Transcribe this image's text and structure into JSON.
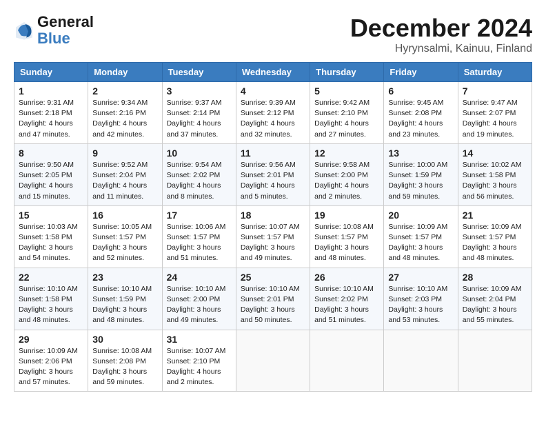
{
  "header": {
    "logo_general": "General",
    "logo_blue": "Blue",
    "month_title": "December 2024",
    "subtitle": "Hyrynsalmi, Kainuu, Finland"
  },
  "weekdays": [
    "Sunday",
    "Monday",
    "Tuesday",
    "Wednesday",
    "Thursday",
    "Friday",
    "Saturday"
  ],
  "weeks": [
    [
      {
        "day": "1",
        "info": "Sunrise: 9:31 AM\nSunset: 2:18 PM\nDaylight: 4 hours\nand 47 minutes."
      },
      {
        "day": "2",
        "info": "Sunrise: 9:34 AM\nSunset: 2:16 PM\nDaylight: 4 hours\nand 42 minutes."
      },
      {
        "day": "3",
        "info": "Sunrise: 9:37 AM\nSunset: 2:14 PM\nDaylight: 4 hours\nand 37 minutes."
      },
      {
        "day": "4",
        "info": "Sunrise: 9:39 AM\nSunset: 2:12 PM\nDaylight: 4 hours\nand 32 minutes."
      },
      {
        "day": "5",
        "info": "Sunrise: 9:42 AM\nSunset: 2:10 PM\nDaylight: 4 hours\nand 27 minutes."
      },
      {
        "day": "6",
        "info": "Sunrise: 9:45 AM\nSunset: 2:08 PM\nDaylight: 4 hours\nand 23 minutes."
      },
      {
        "day": "7",
        "info": "Sunrise: 9:47 AM\nSunset: 2:07 PM\nDaylight: 4 hours\nand 19 minutes."
      }
    ],
    [
      {
        "day": "8",
        "info": "Sunrise: 9:50 AM\nSunset: 2:05 PM\nDaylight: 4 hours\nand 15 minutes."
      },
      {
        "day": "9",
        "info": "Sunrise: 9:52 AM\nSunset: 2:04 PM\nDaylight: 4 hours\nand 11 minutes."
      },
      {
        "day": "10",
        "info": "Sunrise: 9:54 AM\nSunset: 2:02 PM\nDaylight: 4 hours\nand 8 minutes."
      },
      {
        "day": "11",
        "info": "Sunrise: 9:56 AM\nSunset: 2:01 PM\nDaylight: 4 hours\nand 5 minutes."
      },
      {
        "day": "12",
        "info": "Sunrise: 9:58 AM\nSunset: 2:00 PM\nDaylight: 4 hours\nand 2 minutes."
      },
      {
        "day": "13",
        "info": "Sunrise: 10:00 AM\nSunset: 1:59 PM\nDaylight: 3 hours\nand 59 minutes."
      },
      {
        "day": "14",
        "info": "Sunrise: 10:02 AM\nSunset: 1:58 PM\nDaylight: 3 hours\nand 56 minutes."
      }
    ],
    [
      {
        "day": "15",
        "info": "Sunrise: 10:03 AM\nSunset: 1:58 PM\nDaylight: 3 hours\nand 54 minutes."
      },
      {
        "day": "16",
        "info": "Sunrise: 10:05 AM\nSunset: 1:57 PM\nDaylight: 3 hours\nand 52 minutes."
      },
      {
        "day": "17",
        "info": "Sunrise: 10:06 AM\nSunset: 1:57 PM\nDaylight: 3 hours\nand 51 minutes."
      },
      {
        "day": "18",
        "info": "Sunrise: 10:07 AM\nSunset: 1:57 PM\nDaylight: 3 hours\nand 49 minutes."
      },
      {
        "day": "19",
        "info": "Sunrise: 10:08 AM\nSunset: 1:57 PM\nDaylight: 3 hours\nand 48 minutes."
      },
      {
        "day": "20",
        "info": "Sunrise: 10:09 AM\nSunset: 1:57 PM\nDaylight: 3 hours\nand 48 minutes."
      },
      {
        "day": "21",
        "info": "Sunrise: 10:09 AM\nSunset: 1:57 PM\nDaylight: 3 hours\nand 48 minutes."
      }
    ],
    [
      {
        "day": "22",
        "info": "Sunrise: 10:10 AM\nSunset: 1:58 PM\nDaylight: 3 hours\nand 48 minutes."
      },
      {
        "day": "23",
        "info": "Sunrise: 10:10 AM\nSunset: 1:59 PM\nDaylight: 3 hours\nand 48 minutes."
      },
      {
        "day": "24",
        "info": "Sunrise: 10:10 AM\nSunset: 2:00 PM\nDaylight: 3 hours\nand 49 minutes."
      },
      {
        "day": "25",
        "info": "Sunrise: 10:10 AM\nSunset: 2:01 PM\nDaylight: 3 hours\nand 50 minutes."
      },
      {
        "day": "26",
        "info": "Sunrise: 10:10 AM\nSunset: 2:02 PM\nDaylight: 3 hours\nand 51 minutes."
      },
      {
        "day": "27",
        "info": "Sunrise: 10:10 AM\nSunset: 2:03 PM\nDaylight: 3 hours\nand 53 minutes."
      },
      {
        "day": "28",
        "info": "Sunrise: 10:09 AM\nSunset: 2:04 PM\nDaylight: 3 hours\nand 55 minutes."
      }
    ],
    [
      {
        "day": "29",
        "info": "Sunrise: 10:09 AM\nSunset: 2:06 PM\nDaylight: 3 hours\nand 57 minutes."
      },
      {
        "day": "30",
        "info": "Sunrise: 10:08 AM\nSunset: 2:08 PM\nDaylight: 3 hours\nand 59 minutes."
      },
      {
        "day": "31",
        "info": "Sunrise: 10:07 AM\nSunset: 2:10 PM\nDaylight: 4 hours\nand 2 minutes."
      },
      null,
      null,
      null,
      null
    ]
  ]
}
